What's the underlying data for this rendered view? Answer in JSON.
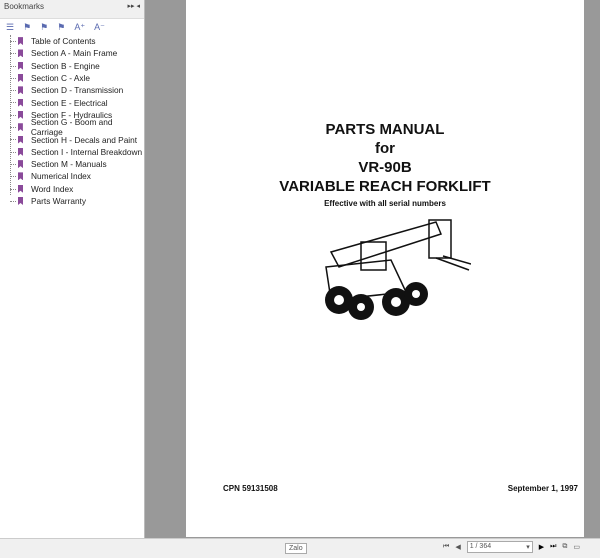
{
  "sidebar": {
    "title": "Bookmarks",
    "items": [
      "Table of Contents",
      "Section A - Main Frame",
      "Section B - Engine",
      "Section C - Axle",
      "Section D - Transmission",
      "Section E - Electrical",
      "Section F - Hydraulics",
      "Section G - Boom and Carriage",
      "Section H - Decals and Paint",
      "Section I - Internal Breakdown",
      "Section M - Manuals",
      "Numerical Index",
      "Word Index",
      "Parts Warranty"
    ]
  },
  "page": {
    "line1": "PARTS MANUAL",
    "line2": "for",
    "line3": "VR-90B",
    "line4": "VARIABLE REACH FORKLIFT",
    "line5": "Effective with all serial numbers",
    "cpn": "CPN 59131508",
    "date": "September 1, 1997"
  },
  "footer": {
    "zoom": "Zalo",
    "page": "1 / 364"
  }
}
